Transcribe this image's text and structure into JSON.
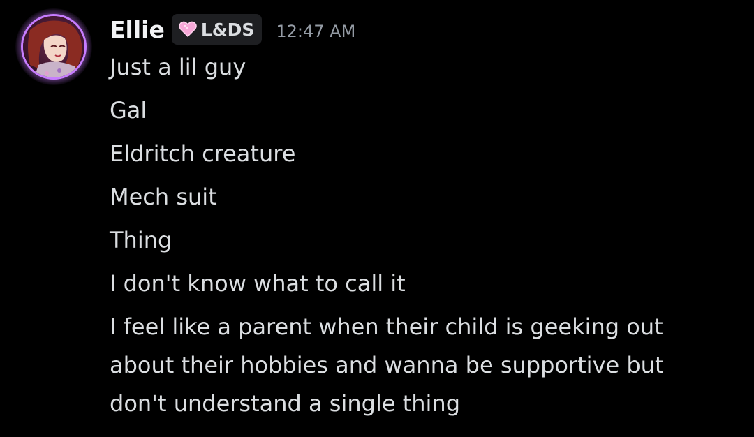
{
  "message": {
    "author": "Ellie",
    "tag": {
      "label": "L&DS",
      "icon": "pink-heart-icon",
      "icon_color": "#f7a8d8"
    },
    "timestamp": "12:47 AM",
    "lines": [
      "Just a lil guy",
      "Gal",
      "Eldritch creature",
      "Mech suit",
      "Thing",
      "I don't know what to call it",
      "I feel like a parent when their child is geeking out about their hobbies and wanna be supportive but don't understand a single thing"
    ]
  },
  "colors": {
    "background": "#000000",
    "username": "#f2f3f5",
    "text": "#dbdee1",
    "timestamp": "#949ba4",
    "avatar_ring": "#c77dff"
  }
}
